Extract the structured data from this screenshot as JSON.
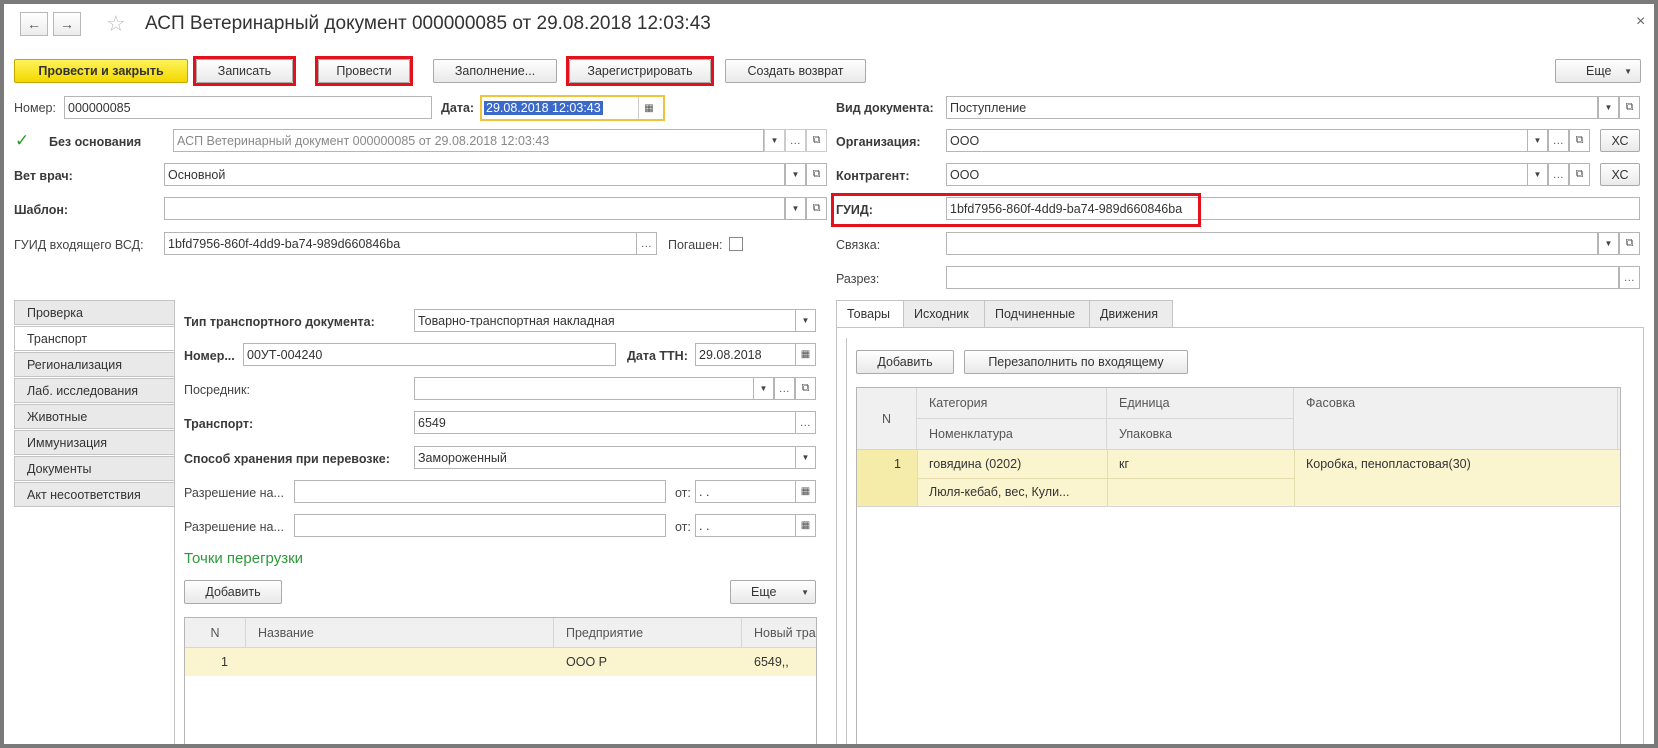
{
  "window": {
    "title": "АСП Ветеринарный документ 000000085 от 29.08.2018 12:03:43",
    "back_icon": "←",
    "forward_icon": "→",
    "star_icon": "☆",
    "close_icon": "×"
  },
  "toolbar": {
    "post_close": "Провести и закрыть",
    "save": "Записать",
    "post": "Провести",
    "fill": "Заполнение...",
    "register": "Зарегистрировать",
    "create_return": "Создать возврат",
    "more": "Еще"
  },
  "header": {
    "number_label": "Номер:",
    "number_value": "000000085",
    "date_label": "Дата:",
    "date_value": "29.08.2018 12:03:43",
    "no_basis_label": "Без основания",
    "basis_value": "АСП Ветеринарный документ 000000085 от 29.08.2018 12:03:43",
    "vet_label": "Вет врач:",
    "vet_value": "Основной",
    "template_label": "Шаблон:",
    "template_value": "",
    "incoming_guid_label": "ГУИД входящего ВСД:",
    "incoming_guid_value": "1bfd7956-860f-4dd9-ba74-989d660846ba",
    "repaid_label": "Погашен:",
    "doc_type_label": "Вид документа:",
    "doc_type_value": "Поступление",
    "org_label": "Организация:",
    "org_value": "ООО",
    "contractor_label": "Контрагент:",
    "contractor_value": "ООО",
    "xc": "ХС",
    "guid_label": "ГУИД:",
    "guid_value": "1bfd7956-860f-4dd9-ba74-989d660846ba",
    "link_label": "Связка:",
    "link_value": "",
    "cut_label": "Разрез:",
    "cut_value": ""
  },
  "left_tabs": [
    "Проверка",
    "Транспорт",
    "Регионализация",
    "Лаб. исследования",
    "Животные",
    "Иммунизация",
    "Документы",
    "Акт несоответствия"
  ],
  "transport": {
    "doc_type_label": "Тип транспортного документа:",
    "doc_type_value": "Товарно-транспортная накладная",
    "number_label": "Номер...",
    "number_value": "00УТ-004240",
    "ttn_date_label": "Дата ТТН:",
    "ttn_date_value": "29.08.2018",
    "intermediary_label": "Посредник:",
    "intermediary_value": "",
    "transport_label": "Транспорт:",
    "transport_value": "6549",
    "storage_label": "Способ хранения при перевозке:",
    "storage_value": "Замороженный",
    "permit1_label": "Разрешение на...",
    "permit2_label": "Разрешение на...",
    "from_label": "от:",
    "empty_date": " .  .",
    "reload_title": "Точки перегрузки",
    "add": "Добавить",
    "more": "Еще",
    "cols": [
      "N",
      "Название",
      "Предприятие",
      "Новый тра"
    ],
    "rows": [
      {
        "n": "1",
        "name": "",
        "enterprise": "ООО Р",
        "transport": "6549,,"
      }
    ]
  },
  "right_tabs": [
    "Товары",
    "Исходник",
    "Подчиненные",
    "Движения"
  ],
  "goods": {
    "add": "Добавить",
    "refill": "Перезаполнить по входящему",
    "cols": {
      "n": "N",
      "category": "Категория",
      "nomenclature": "Номенклатура",
      "unit": "Единица",
      "package": "Упаковка",
      "packing": "Фасовка"
    },
    "rows": [
      {
        "n": "1",
        "category": "говядина (0202)",
        "nomenclature": "Люля-кебаб, вес, Кули...",
        "unit": "кг",
        "package": "",
        "packing": "Коробка, пенопластовая(30)"
      }
    ]
  },
  "colors": {
    "highlight_red": "#e3111b",
    "primary_yellow": "#f2d800",
    "selected_row": "#fbf5cf",
    "green_title": "#2c9a3a"
  }
}
